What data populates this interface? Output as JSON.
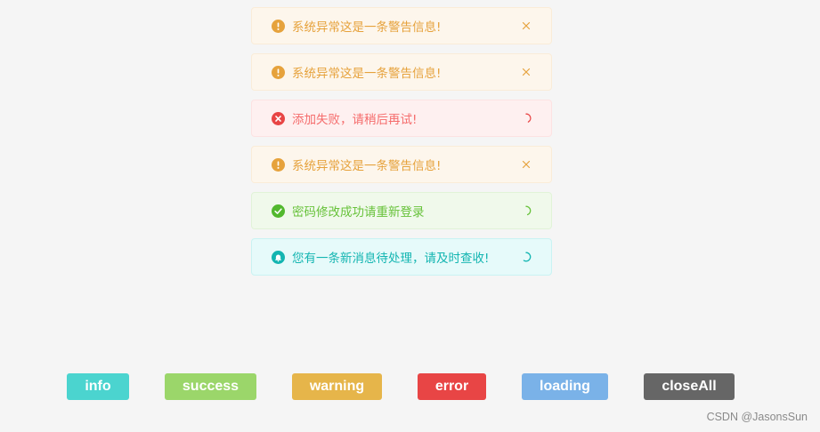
{
  "toasts": [
    {
      "type": "warning",
      "icon": "exclamation-circle-icon",
      "message": "系统异常这是一条警告信息!",
      "action": "close-icon"
    },
    {
      "type": "warning",
      "icon": "exclamation-circle-icon",
      "message": "系统异常这是一条警告信息!",
      "action": "close-icon"
    },
    {
      "type": "error",
      "icon": "x-circle-icon",
      "message": "添加失败，请稍后再试!",
      "action": "loading-spinner-icon"
    },
    {
      "type": "warning",
      "icon": "exclamation-circle-icon",
      "message": "系统异常这是一条警告信息!",
      "action": "close-icon"
    },
    {
      "type": "success",
      "icon": "check-circle-icon",
      "message": "密码修改成功请重新登录",
      "action": "loading-spinner-icon"
    },
    {
      "type": "info",
      "icon": "bell-circle-icon",
      "message": "您有一条新消息待处理，请及时查收!",
      "action": "loading-spinner-icon"
    }
  ],
  "buttons": {
    "info": "info",
    "success": "success",
    "warning": "warning",
    "error": "error",
    "loading": "loading",
    "closeAll": "closeAll"
  },
  "colors": {
    "info": "#4bd4cf",
    "success": "#9bd66a",
    "warning": "#e6b54a",
    "error": "#e84545",
    "loading": "#7ab2e8",
    "closeAll": "#666666"
  },
  "watermark": "CSDN @JasonsSun"
}
